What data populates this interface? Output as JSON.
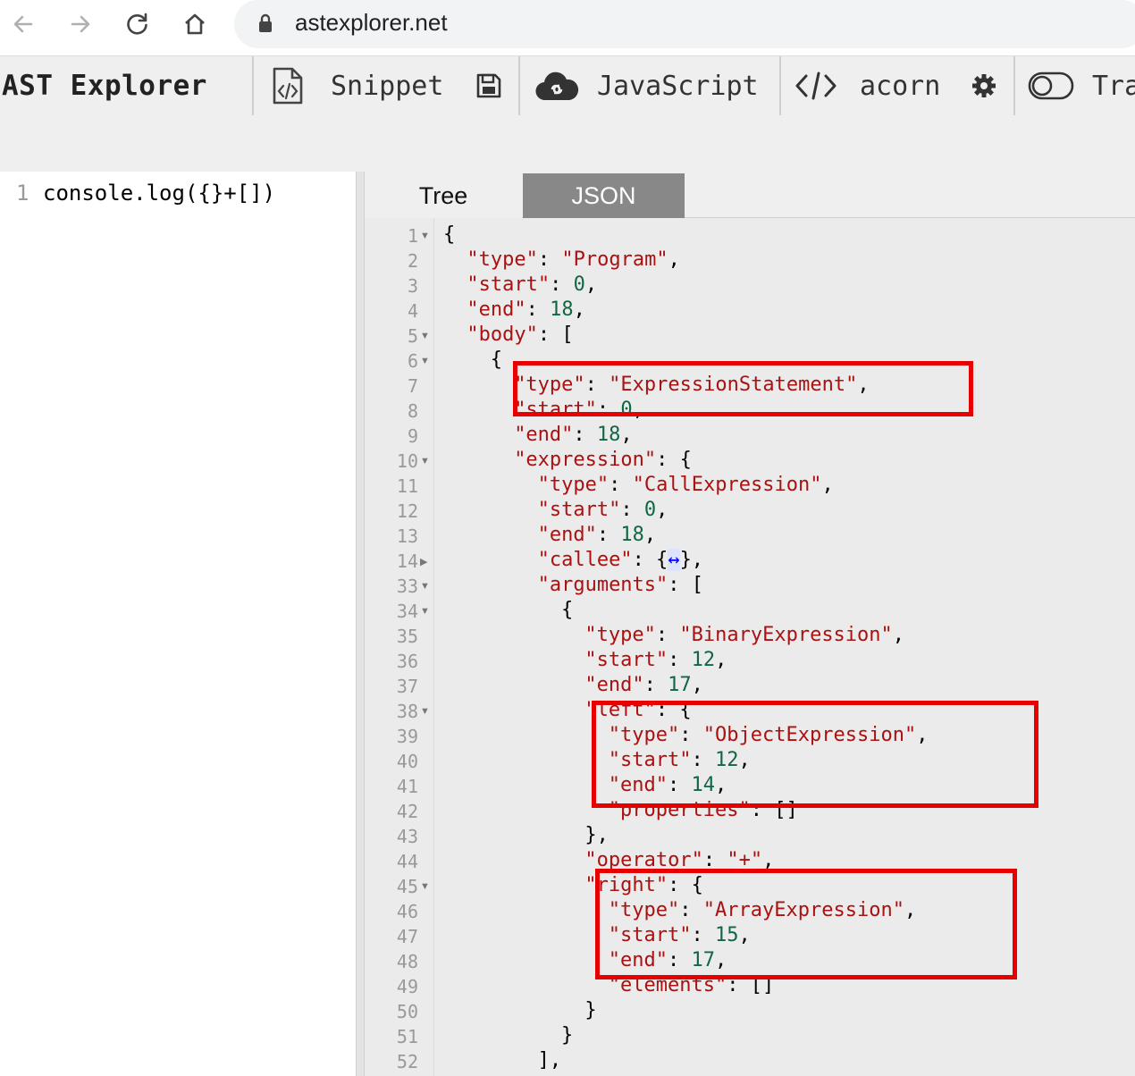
{
  "browser": {
    "url": "astexplorer.net"
  },
  "toolbar": {
    "brand": "AST Explorer",
    "snippet": "Snippet",
    "language": "JavaScript",
    "parser": "acorn",
    "transform": "Tra"
  },
  "editor": {
    "line_number": "1",
    "code": "console.log({}+[])"
  },
  "output": {
    "tab_tree": "Tree",
    "tab_json": "JSON",
    "line_numbers": [
      "1",
      "2",
      "3",
      "4",
      "5",
      "6",
      "7",
      "8",
      "9",
      "10",
      "11",
      "12",
      "13",
      "14",
      "33",
      "34",
      "35",
      "36",
      "37",
      "38",
      "39",
      "40",
      "41",
      "42",
      "43",
      "44",
      "45",
      "46",
      "47",
      "48",
      "49",
      "50",
      "51",
      "52"
    ],
    "lines": [
      {
        "indent": 0,
        "tokens": [
          [
            "p",
            "{"
          ]
        ],
        "fold": "down"
      },
      {
        "indent": 1,
        "tokens": [
          [
            "k",
            "\"type\""
          ],
          [
            "p",
            ": "
          ],
          [
            "s",
            "\"Program\""
          ],
          [
            "p",
            ","
          ]
        ]
      },
      {
        "indent": 1,
        "tokens": [
          [
            "k",
            "\"start\""
          ],
          [
            "p",
            ": "
          ],
          [
            "n",
            "0"
          ],
          [
            "p",
            ","
          ]
        ]
      },
      {
        "indent": 1,
        "tokens": [
          [
            "k",
            "\"end\""
          ],
          [
            "p",
            ": "
          ],
          [
            "n",
            "18"
          ],
          [
            "p",
            ","
          ]
        ]
      },
      {
        "indent": 1,
        "tokens": [
          [
            "k",
            "\"body\""
          ],
          [
            "p",
            ": ["
          ]
        ],
        "fold": "down"
      },
      {
        "indent": 2,
        "tokens": [
          [
            "p",
            "{"
          ]
        ],
        "fold": "down"
      },
      {
        "indent": 3,
        "tokens": [
          [
            "k",
            "\"type\""
          ],
          [
            "p",
            ": "
          ],
          [
            "s",
            "\"ExpressionStatement\""
          ],
          [
            "p",
            ","
          ]
        ]
      },
      {
        "indent": 3,
        "tokens": [
          [
            "k",
            "\"start\""
          ],
          [
            "p",
            ": "
          ],
          [
            "n",
            "0"
          ],
          [
            "p",
            ","
          ]
        ]
      },
      {
        "indent": 3,
        "tokens": [
          [
            "k",
            "\"end\""
          ],
          [
            "p",
            ": "
          ],
          [
            "n",
            "18"
          ],
          [
            "p",
            ","
          ]
        ]
      },
      {
        "indent": 3,
        "tokens": [
          [
            "k",
            "\"expression\""
          ],
          [
            "p",
            ": {"
          ]
        ],
        "fold": "down"
      },
      {
        "indent": 4,
        "tokens": [
          [
            "k",
            "\"type\""
          ],
          [
            "p",
            ": "
          ],
          [
            "s",
            "\"CallExpression\""
          ],
          [
            "p",
            ","
          ]
        ]
      },
      {
        "indent": 4,
        "tokens": [
          [
            "k",
            "\"start\""
          ],
          [
            "p",
            ": "
          ],
          [
            "n",
            "0"
          ],
          [
            "p",
            ","
          ]
        ]
      },
      {
        "indent": 4,
        "tokens": [
          [
            "k",
            "\"end\""
          ],
          [
            "p",
            ": "
          ],
          [
            "n",
            "18"
          ],
          [
            "p",
            ","
          ]
        ]
      },
      {
        "indent": 4,
        "tokens": [
          [
            "k",
            "\"callee\""
          ],
          [
            "p",
            ": {"
          ],
          [
            "ell",
            "↔"
          ],
          [
            "p",
            "},"
          ]
        ],
        "fold": "right"
      },
      {
        "indent": 4,
        "tokens": [
          [
            "k",
            "\"arguments\""
          ],
          [
            "p",
            ": ["
          ]
        ],
        "fold": "down"
      },
      {
        "indent": 5,
        "tokens": [
          [
            "p",
            "{"
          ]
        ],
        "fold": "down"
      },
      {
        "indent": 6,
        "tokens": [
          [
            "k",
            "\"type\""
          ],
          [
            "p",
            ": "
          ],
          [
            "s",
            "\"BinaryExpression\""
          ],
          [
            "p",
            ","
          ]
        ]
      },
      {
        "indent": 6,
        "tokens": [
          [
            "k",
            "\"start\""
          ],
          [
            "p",
            ": "
          ],
          [
            "n",
            "12"
          ],
          [
            "p",
            ","
          ]
        ]
      },
      {
        "indent": 6,
        "tokens": [
          [
            "k",
            "\"end\""
          ],
          [
            "p",
            ": "
          ],
          [
            "n",
            "17"
          ],
          [
            "p",
            ","
          ]
        ]
      },
      {
        "indent": 6,
        "tokens": [
          [
            "k",
            "\"left\""
          ],
          [
            "p",
            ": {"
          ]
        ],
        "fold": "down"
      },
      {
        "indent": 7,
        "tokens": [
          [
            "k",
            "\"type\""
          ],
          [
            "p",
            ": "
          ],
          [
            "s",
            "\"ObjectExpression\""
          ],
          [
            "p",
            ","
          ]
        ]
      },
      {
        "indent": 7,
        "tokens": [
          [
            "k",
            "\"start\""
          ],
          [
            "p",
            ": "
          ],
          [
            "n",
            "12"
          ],
          [
            "p",
            ","
          ]
        ]
      },
      {
        "indent": 7,
        "tokens": [
          [
            "k",
            "\"end\""
          ],
          [
            "p",
            ": "
          ],
          [
            "n",
            "14"
          ],
          [
            "p",
            ","
          ]
        ]
      },
      {
        "indent": 7,
        "tokens": [
          [
            "k",
            "\"properties\""
          ],
          [
            "p",
            ": []"
          ]
        ]
      },
      {
        "indent": 6,
        "tokens": [
          [
            "p",
            "},"
          ]
        ]
      },
      {
        "indent": 6,
        "tokens": [
          [
            "k",
            "\"operator\""
          ],
          [
            "p",
            ": "
          ],
          [
            "s",
            "\"+\""
          ],
          [
            "p",
            ","
          ]
        ]
      },
      {
        "indent": 6,
        "tokens": [
          [
            "k",
            "\"right\""
          ],
          [
            "p",
            ": {"
          ]
        ],
        "fold": "down"
      },
      {
        "indent": 7,
        "tokens": [
          [
            "k",
            "\"type\""
          ],
          [
            "p",
            ": "
          ],
          [
            "s",
            "\"ArrayExpression\""
          ],
          [
            "p",
            ","
          ]
        ]
      },
      {
        "indent": 7,
        "tokens": [
          [
            "k",
            "\"start\""
          ],
          [
            "p",
            ": "
          ],
          [
            "n",
            "15"
          ],
          [
            "p",
            ","
          ]
        ]
      },
      {
        "indent": 7,
        "tokens": [
          [
            "k",
            "\"end\""
          ],
          [
            "p",
            ": "
          ],
          [
            "n",
            "17"
          ],
          [
            "p",
            ","
          ]
        ]
      },
      {
        "indent": 7,
        "tokens": [
          [
            "k",
            "\"elements\""
          ],
          [
            "p",
            ": []"
          ]
        ]
      },
      {
        "indent": 6,
        "tokens": [
          [
            "p",
            "}"
          ]
        ]
      },
      {
        "indent": 5,
        "tokens": [
          [
            "p",
            "}"
          ]
        ]
      },
      {
        "indent": 4,
        "tokens": [
          [
            "p",
            "],"
          ]
        ]
      }
    ]
  },
  "colors": {
    "highlight_box": "#e60000",
    "json_key": "#aa1111",
    "json_number": "#116644"
  }
}
